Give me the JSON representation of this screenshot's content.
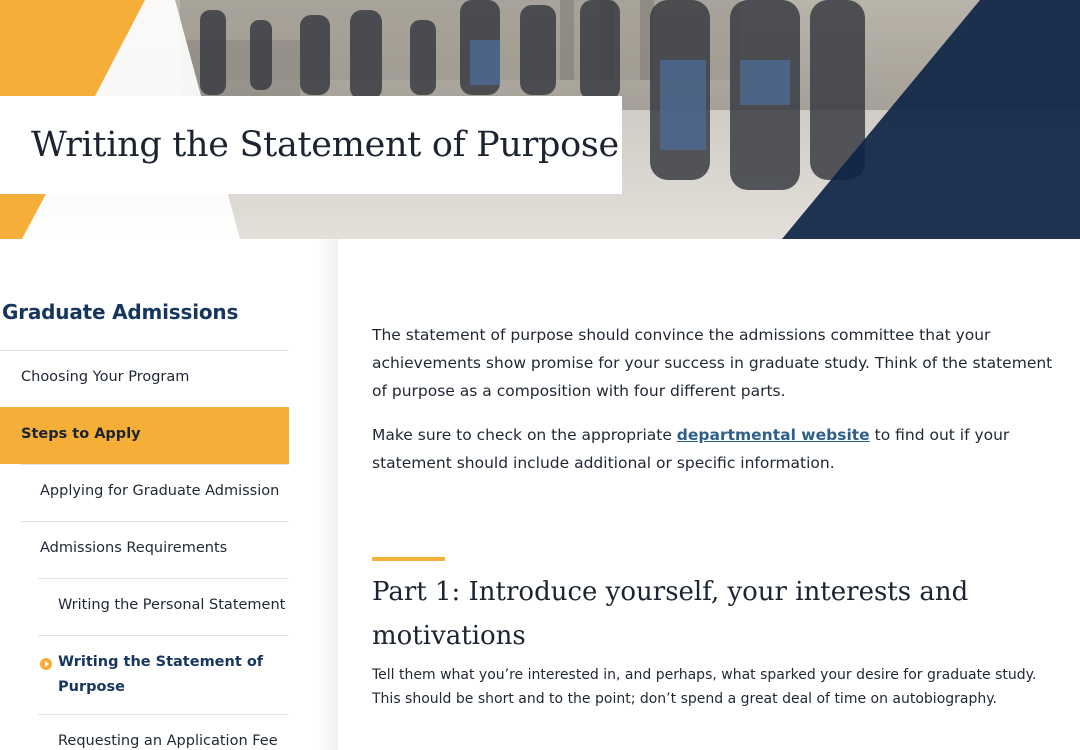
{
  "hero": {
    "title": "Writing the Statement of Purpose"
  },
  "sidebar": {
    "heading": "Graduate Admissions",
    "items": [
      {
        "label": "Choosing Your Program",
        "level": 0
      },
      {
        "label": "Steps to Apply",
        "level": 0,
        "state": "active-section"
      },
      {
        "label": "Applying for Graduate Admission",
        "level": 1
      },
      {
        "label": "Admissions Requirements",
        "level": 1
      },
      {
        "label": "Writing the Personal Statement",
        "level": 2
      },
      {
        "label": "Writing the Statement of Purpose",
        "level": 2,
        "state": "current"
      },
      {
        "label": "Requesting an Application Fee",
        "level": 2
      }
    ]
  },
  "main": {
    "intro": "The statement of purpose should convince the admissions committee that your achievements show promise for your success in graduate study. Think of the statement of purpose as a composition with four different parts.",
    "check": {
      "before": "Make sure to check on the appropriate ",
      "link": "departmental website",
      "after": " to find out if your statement should include additional or specific information."
    },
    "part1": {
      "title": "Part 1: Introduce yourself, your interests and motivations",
      "body": "Tell them what you’re interested in, and perhaps, what sparked your desire for graduate study. This should be short and to the point; don’t spend a great deal of time on autobiography."
    }
  },
  "colors": {
    "accent": "#f5ae37",
    "navy": "#16365e",
    "link": "#2e5f8a"
  }
}
